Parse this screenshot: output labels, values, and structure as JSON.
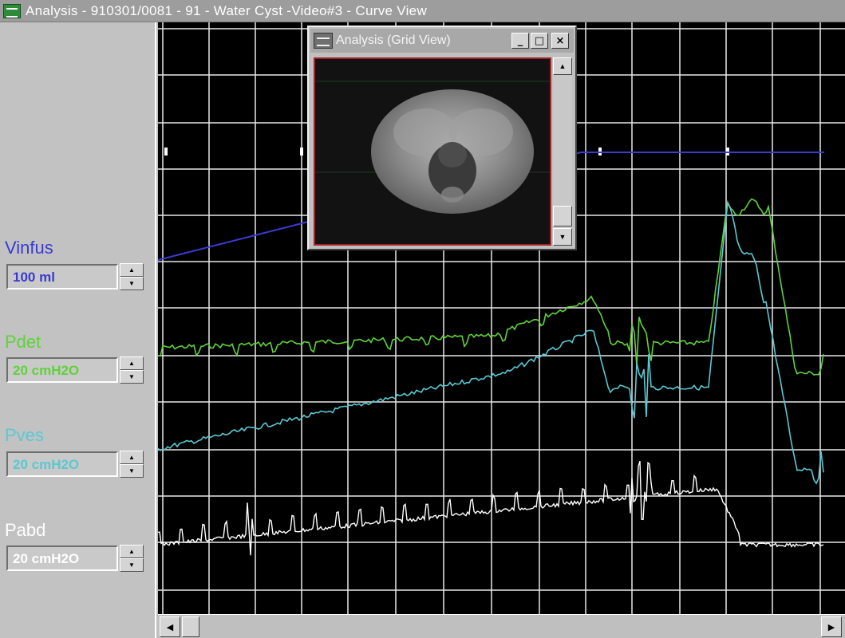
{
  "window": {
    "title": "Analysis - 910301/0081 - 91 - Water Cyst -Video#3 - Curve View",
    "icon": "graph-icon"
  },
  "channels": [
    {
      "id": "vinfus",
      "label": "Vinfus",
      "scale": "100 ml",
      "color": "#3a3ad2"
    },
    {
      "id": "pdet",
      "label": "Pdet",
      "scale": "20 cmH2O",
      "color": "#5fd23a"
    },
    {
      "id": "pves",
      "label": "Pves",
      "scale": "20 cmH2O",
      "color": "#5ac8d2"
    },
    {
      "id": "pabd",
      "label": "Pabd",
      "scale": "20 cmH2O",
      "color": "#ffffff"
    }
  ],
  "grid_view": {
    "title": "Analysis (Grid View)",
    "icon": "graph-icon",
    "buttons": {
      "minimize": "_",
      "maximize": "□",
      "close": "×"
    },
    "image": "fluoroscopy-image"
  },
  "colors": {
    "plot_background": "#000000",
    "grid": "#e8e8e8",
    "panel": "#c2c2c2"
  }
}
